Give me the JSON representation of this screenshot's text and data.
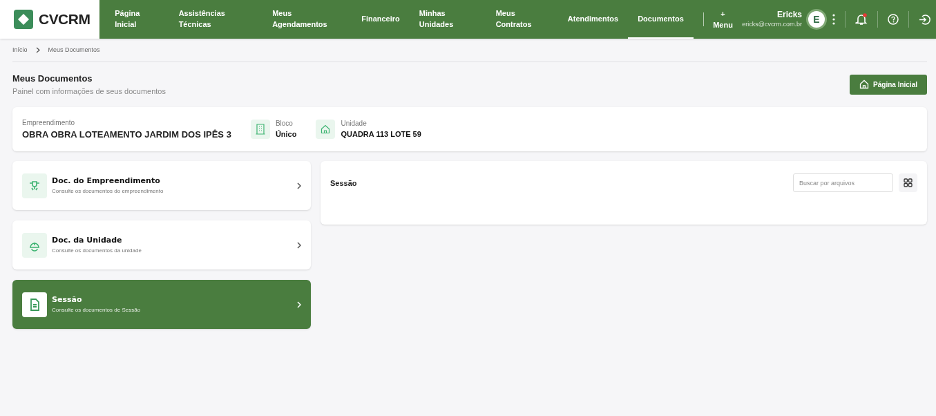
{
  "header": {
    "logo_text": "CVCRM",
    "nav": [
      {
        "label": "Página Inicial",
        "selected": false
      },
      {
        "label": "Assistências Técnicas",
        "selected": false
      },
      {
        "label": "Meus Agendamentos",
        "selected": false
      },
      {
        "label": "Financeiro",
        "selected": false
      },
      {
        "label": "Minhas Unidades",
        "selected": false
      },
      {
        "label": "Meus Contratos",
        "selected": false
      },
      {
        "label": "Atendimentos",
        "selected": false
      },
      {
        "label": "Documentos",
        "selected": true
      }
    ],
    "menu_button": "+ Menu",
    "user": {
      "name": "Ericks",
      "email": "ericks@cvcrm.com.br",
      "avatar_letter": "E"
    },
    "notifications_unread": true
  },
  "breadcrumb": [
    "Início",
    "Meus Documentos"
  ],
  "page": {
    "title": "Meus Documentos",
    "subtitle": "Painel com informações de seus documentos",
    "home_button": "Página Inicial"
  },
  "info": {
    "empreendimento_label": "Empreendimento",
    "empreendimento": "OBRA OBRA LOTEAMENTO JARDIM DOS IPÊS 3",
    "bloco_label": "Bloco",
    "bloco": "Único",
    "unidade_label": "Unidade",
    "unidade": "QUADRA 113 LOTE 59"
  },
  "categories": [
    {
      "kind": "empreendimento",
      "title": "Doc. do Empreendimento",
      "description": "Consulte os documentos do empreendimento",
      "selected": false
    },
    {
      "kind": "unidade",
      "title": "Doc. da Unidade",
      "description": "Consulte os documentos da unidade",
      "selected": false
    },
    {
      "kind": "sessao",
      "title": "Sessão",
      "description": "Consulte os documentos de Sessão",
      "selected": true
    }
  ],
  "panel": {
    "title": "Sessão",
    "search_placeholder": "Buscar por arquivos"
  }
}
